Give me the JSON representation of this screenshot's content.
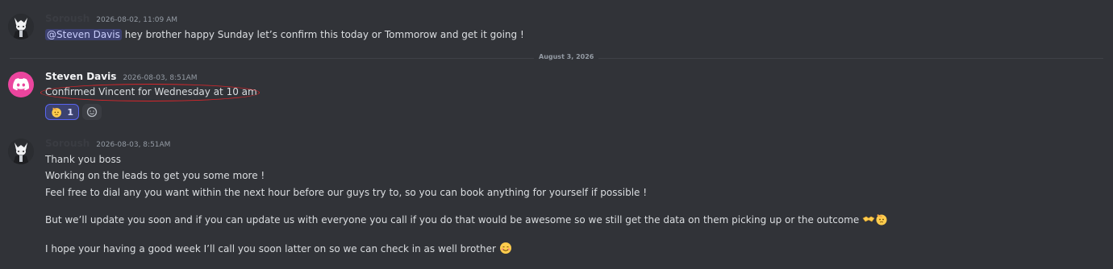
{
  "messages": [
    {
      "author": "Soroush",
      "timestamp": "2026-08-02, 11:09 AM",
      "mention": "@Steven Davis",
      "text": " hey brother happy Sunday let’s confirm this today or Tommorow and get it going !"
    },
    {
      "author": "Steven Davis",
      "timestamp": "2026-08-03, 8:51AM",
      "text": "Confirmed Vincent for Wednesday at 10 am",
      "reactions": [
        {
          "icon": "saluting-face-emoji",
          "count": "1"
        }
      ]
    },
    {
      "author": "Soroush",
      "timestamp": "2026-08-03, 8:51AM",
      "lines": [
        "Thank you boss",
        "Working on the leads to get you some more !",
        "Feel free to dial any you want within the next hour before our guys try to, so you can book anything for yourself if possible !",
        "But we’ll update you soon and if you can update us with everyone you call if you do that would be awesome so we still get the data on them picking up or the outcome ",
        "I hope your having a good week I’ll call you soon latter on so we can check in as well brother "
      ]
    }
  ],
  "date_divider": "August 3, 2026",
  "colors": {
    "background": "#313338",
    "mention_bg": "#3c4270",
    "highlight": "#d8262b",
    "discord_avatar": "#eb459e"
  }
}
